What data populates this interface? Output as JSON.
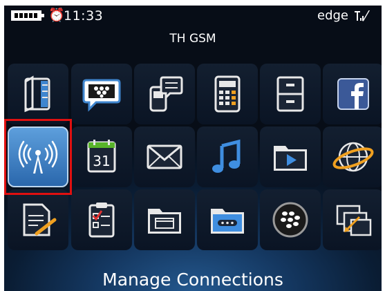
{
  "statusbar": {
    "time": "11:33",
    "alarm_icon": "alarm-clock-icon",
    "network_type": "edge",
    "battery_icon": "battery-full-icon",
    "signal_icon": "signal-strength-icon"
  },
  "carrier": "TH GSM",
  "selected_app_label": "Manage Connections",
  "apps": [
    {
      "row": 1,
      "col": 1,
      "icon": "contacts-icon",
      "selected": false
    },
    {
      "row": 1,
      "col": 2,
      "icon": "blackberry-messenger-icon",
      "selected": false
    },
    {
      "row": 1,
      "col": 3,
      "icon": "text-messages-icon",
      "selected": false
    },
    {
      "row": 1,
      "col": 4,
      "icon": "calculator-icon",
      "selected": false
    },
    {
      "row": 1,
      "col": 5,
      "icon": "file-cabinet-icon",
      "selected": false
    },
    {
      "row": 1,
      "col": 6,
      "icon": "facebook-icon",
      "selected": false
    },
    {
      "row": 2,
      "col": 1,
      "icon": "manage-connections-icon",
      "selected": true
    },
    {
      "row": 2,
      "col": 2,
      "icon": "calendar-icon",
      "selected": false,
      "text": "31"
    },
    {
      "row": 2,
      "col": 3,
      "icon": "messages-envelope-icon",
      "selected": false
    },
    {
      "row": 2,
      "col": 4,
      "icon": "music-note-icon",
      "selected": false
    },
    {
      "row": 2,
      "col": 5,
      "icon": "media-folder-icon",
      "selected": false
    },
    {
      "row": 2,
      "col": 6,
      "icon": "browser-globe-icon",
      "selected": false
    },
    {
      "row": 3,
      "col": 1,
      "icon": "memo-pad-icon",
      "selected": false
    },
    {
      "row": 3,
      "col": 2,
      "icon": "tasks-icon",
      "selected": false
    },
    {
      "row": 3,
      "col": 3,
      "icon": "applications-folder-icon",
      "selected": false
    },
    {
      "row": 3,
      "col": 4,
      "icon": "downloads-folder-icon",
      "selected": false
    },
    {
      "row": 3,
      "col": 5,
      "icon": "blackberry-app-world-icon",
      "selected": false
    },
    {
      "row": 3,
      "col": 6,
      "icon": "switch-application-icon",
      "selected": false
    }
  ],
  "colors": {
    "highlight_box": "#e01010",
    "selected_tile": "#3d7fc4",
    "background": "#0a1d34"
  }
}
